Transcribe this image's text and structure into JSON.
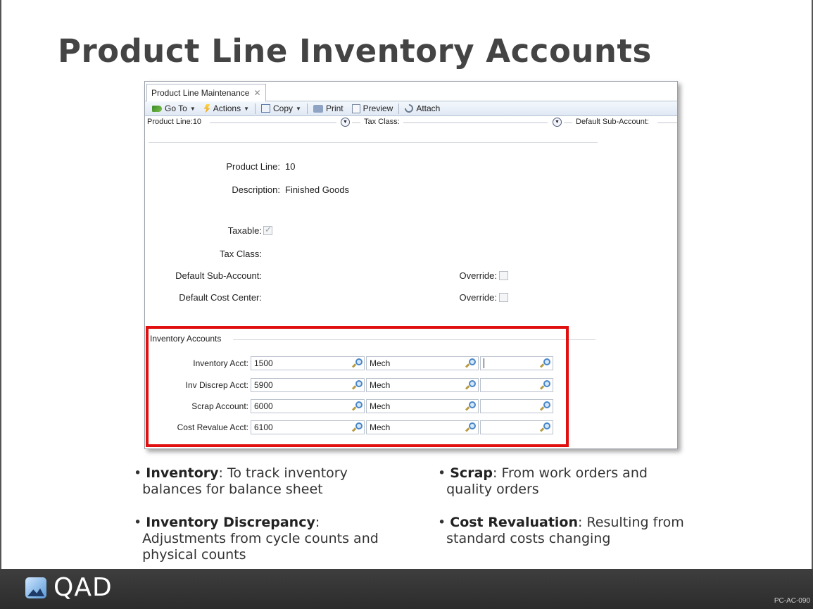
{
  "slide": {
    "title": "Product Line Inventory Accounts",
    "slide_code": "PC-AC-090",
    "logo_text": "QAD"
  },
  "window": {
    "tab_label": "Product Line Maintenance",
    "toolbar": {
      "goto": "Go To",
      "actions": "Actions",
      "copy": "Copy",
      "print": "Print",
      "preview": "Preview",
      "attach": "Attach"
    },
    "filter": {
      "product_line": "Product Line:10",
      "tax_class": "Tax Class:",
      "default_sub_account": "Default Sub-Account:"
    },
    "form": {
      "product_line_label": "Product Line:",
      "product_line_value": "10",
      "description_label": "Description:",
      "description_value": "Finished Goods",
      "taxable_label": "Taxable:",
      "taxable_checked": true,
      "tax_class_label": "Tax Class:",
      "default_sub_account_label": "Default Sub-Account:",
      "default_cost_center_label": "Default Cost Center:",
      "override_label_1": "Override:",
      "override_label_2": "Override:"
    },
    "inventory_accounts": {
      "group_title": "Inventory Accounts",
      "rows": [
        {
          "label": "Inventory Acct:",
          "account": "1500",
          "sub_account": "Mech",
          "cost_center": ""
        },
        {
          "label": "Inv Discrep Acct:",
          "account": "5900",
          "sub_account": "Mech",
          "cost_center": ""
        },
        {
          "label": "Scrap Account:",
          "account": "6000",
          "sub_account": "Mech",
          "cost_center": ""
        },
        {
          "label": "Cost Revalue Acct:",
          "account": "6100",
          "sub_account": "Mech",
          "cost_center": ""
        }
      ]
    }
  },
  "bullets": {
    "inventory_term": "Inventory",
    "inventory_text_1": ": To track inventory",
    "inventory_text_2": "balances for balance sheet",
    "discrepancy_term": "Inventory Discrepancy",
    "discrepancy_text_1": ":",
    "discrepancy_text_2": "Adjustments from cycle counts and",
    "discrepancy_text_3": "physical counts",
    "scrap_term": "Scrap",
    "scrap_text_1": ": From work orders and",
    "scrap_text_2": "quality orders",
    "revaluation_term": "Cost Revaluation",
    "revaluation_text_1": ": Resulting from",
    "revaluation_text_2": "standard costs changing"
  },
  "colors": {
    "highlight": "#e01010",
    "footer": "#333333"
  }
}
